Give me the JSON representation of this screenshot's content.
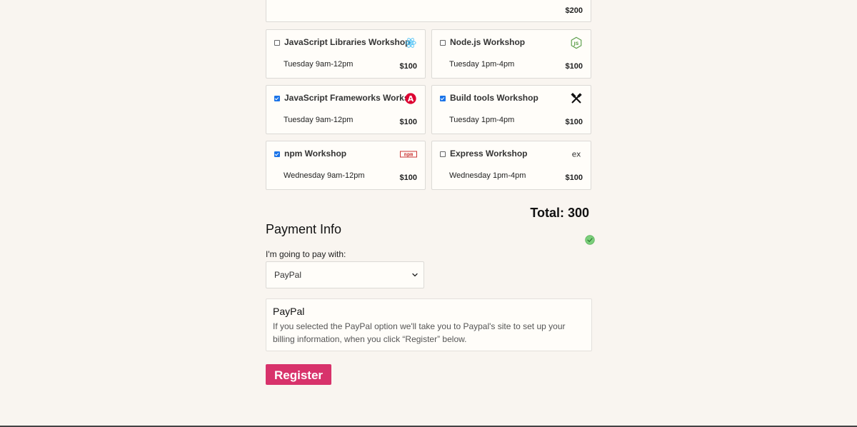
{
  "top_card": {
    "price": "$200"
  },
  "workshops": [
    {
      "title": "JavaScript Libraries Workshop",
      "time": "Tuesday 9am-12pm",
      "price": "$100",
      "checked": false,
      "icon": "react-icon"
    },
    {
      "title": "Node.js Workshop",
      "time": "Tuesday 1pm-4pm",
      "price": "$100",
      "checked": false,
      "icon": "nodejs-icon"
    },
    {
      "title": "JavaScript Frameworks Workshop",
      "time": "Tuesday 9am-12pm",
      "price": "$100",
      "checked": true,
      "icon": "angular-icon"
    },
    {
      "title": "Build tools Workshop",
      "time": "Tuesday 1pm-4pm",
      "price": "$100",
      "checked": true,
      "icon": "tools-icon"
    },
    {
      "title": "npm Workshop",
      "time": "Wednesday 9am-12pm",
      "price": "$100",
      "checked": true,
      "icon": "npm-icon"
    },
    {
      "title": "Express Workshop",
      "time": "Wednesday 1pm-4pm",
      "price": "$100",
      "checked": false,
      "icon": "express-icon"
    }
  ],
  "total": "Total: 300",
  "payment": {
    "heading": "Payment Info",
    "label": "I'm going to pay with:",
    "selected": "PayPal",
    "info_title": "PayPal",
    "info_text": "If you selected the PayPal option we'll take you to Paypal's site to set up your billing information, when you click “Register” below."
  },
  "register_label": "Register",
  "colors": {
    "background": "#f9f5f0",
    "register": "#d8326b",
    "checkbox": "#1a73e8",
    "valid": "#7ccf7c"
  }
}
